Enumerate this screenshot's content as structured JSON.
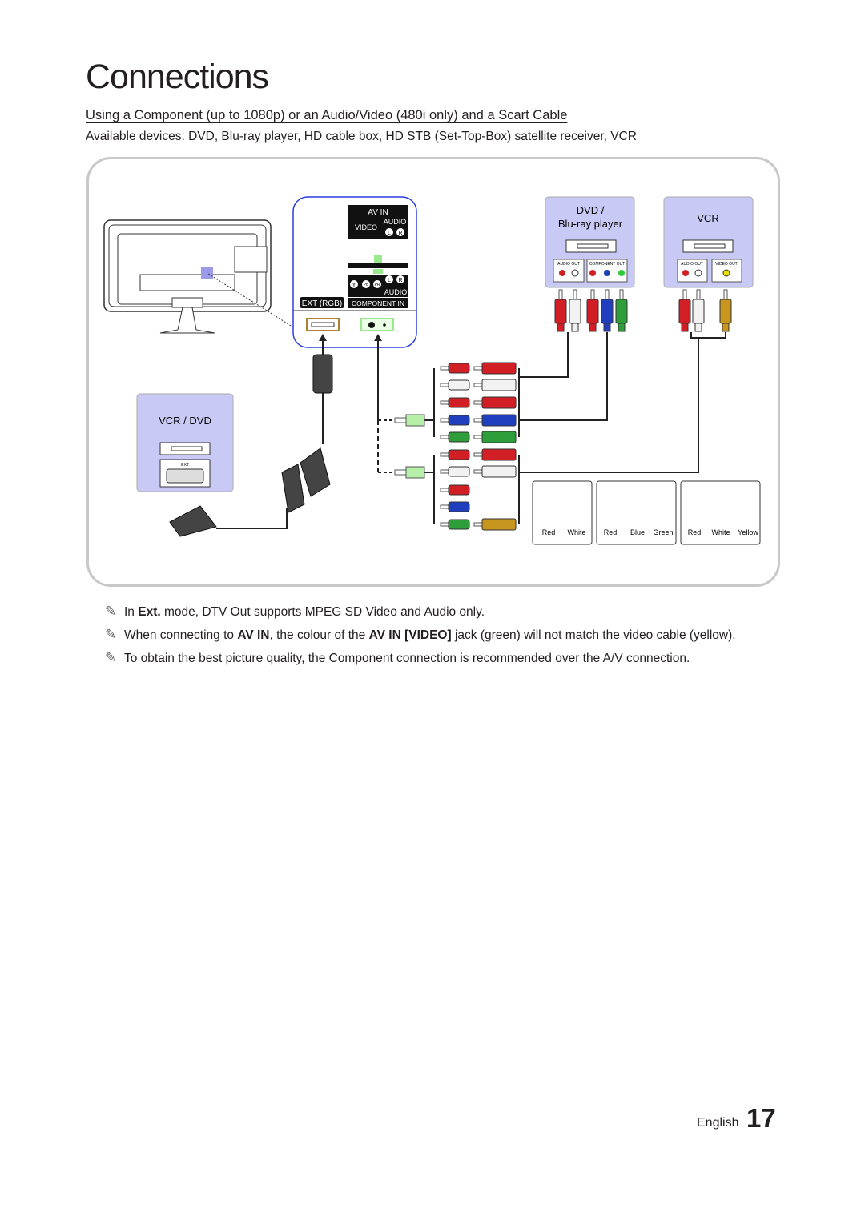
{
  "page": {
    "title": "Connections",
    "subtitle": "Using a Component (up to 1080p) or an Audio/Video (480i only) and a Scart Cable",
    "devices": "Available devices: DVD, Blu-ray player, HD cable box, HD STB (Set-Top-Box) satellite receiver, VCR"
  },
  "diagram": {
    "tv_panel": {
      "av_in": "AV IN",
      "video": "VIDEO",
      "audio": "AUDIO",
      "l": "L",
      "r": "R",
      "y": "Y",
      "pb": "PB",
      "pr": "PR",
      "audio2": "AUDIO",
      "ext_rgb": "EXT (RGB)",
      "component_in": "COMPONENT IN"
    },
    "dvd_box": {
      "title_line1": "DVD /",
      "title_line2": "Blu-ray player",
      "audio_out": "AUDIO OUT",
      "component_out": "COMPONENT OUT"
    },
    "vcr_box": {
      "title": "VCR",
      "audio_out": "AUDIO OUT",
      "video_out": "VIDEO OUT"
    },
    "vcr_dvd_box": {
      "title": "VCR / DVD",
      "ext": "EXT"
    },
    "legend": [
      "Red",
      "White",
      "Red",
      "Blue",
      "Green",
      "Red",
      "White",
      "Yellow"
    ],
    "colors": {
      "red": "#d21f26",
      "white": "#f2f2f2",
      "blue": "#1f3fbf",
      "green": "#2e9e3a",
      "yellow": "#c8961e",
      "device_fill": "#c9c9f5",
      "panel_border": "#2b3de0"
    }
  },
  "notes": [
    {
      "pre": "In ",
      "bold": "Ext.",
      "post": " mode, DTV Out supports MPEG SD Video and Audio only."
    },
    {
      "pre": "When connecting to ",
      "bold": "AV IN",
      "mid": ", the colour of the ",
      "bold2": "AV IN [VIDEO]",
      "post": " jack (green) will not match the video cable (yellow)."
    },
    {
      "pre": "To obtain the best picture quality, the Component connection is recommended over the A/V connection."
    }
  ],
  "footer": {
    "language": "English",
    "page_number": "17"
  }
}
